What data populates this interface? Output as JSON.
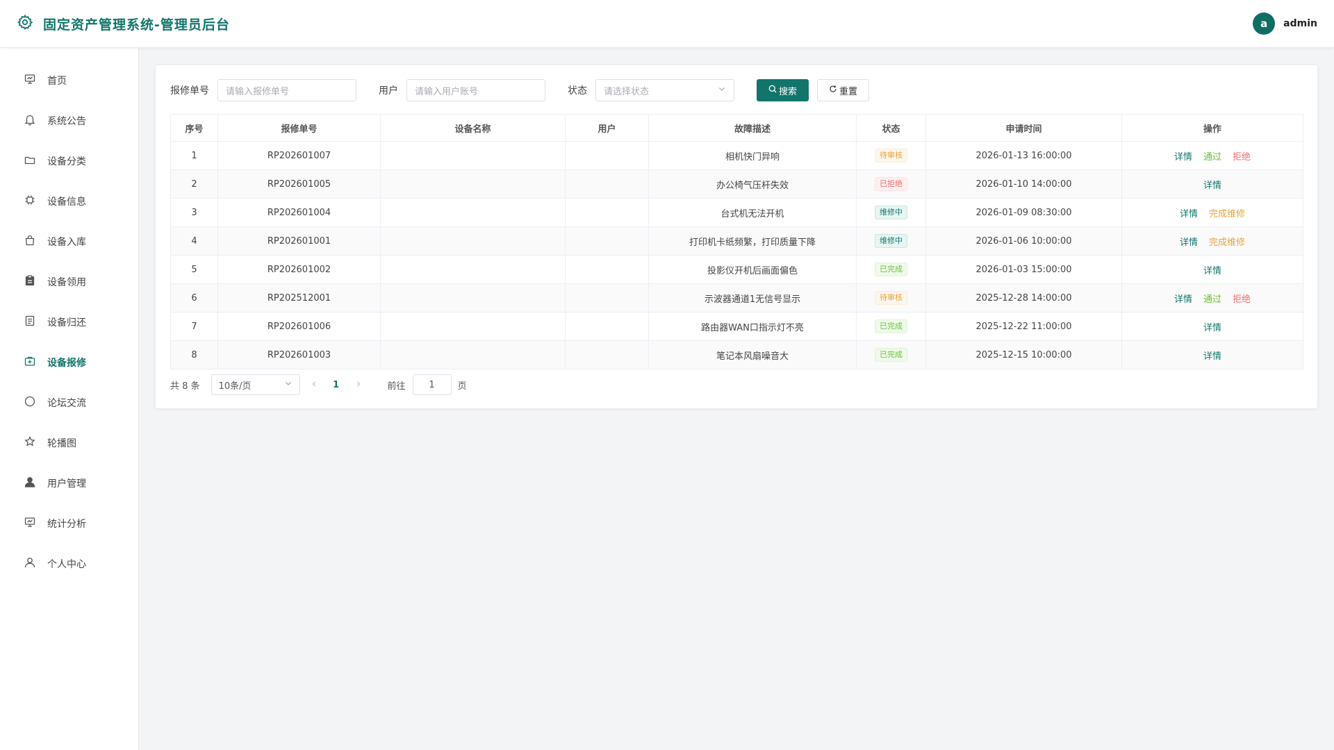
{
  "app": {
    "title": "固定资产管理系统-管理员后台",
    "user": {
      "avatar_letter": "a",
      "name": "admin"
    }
  },
  "colors": {
    "brand": "#11756b",
    "pending": "#e6a23c",
    "rejected": "#f56c6c",
    "done": "#67c23a"
  },
  "sidebar": {
    "items": [
      {
        "label": "首页",
        "icon": "dashboard-icon"
      },
      {
        "label": "系统公告",
        "icon": "bell-icon"
      },
      {
        "label": "设备分类",
        "icon": "folder-icon"
      },
      {
        "label": "设备信息",
        "icon": "chip-icon"
      },
      {
        "label": "设备入库",
        "icon": "bag-icon"
      },
      {
        "label": "设备领用",
        "icon": "clipboard-icon"
      },
      {
        "label": "设备归还",
        "icon": "document-icon"
      },
      {
        "label": "设备报修",
        "icon": "repair-box-icon",
        "active": true
      },
      {
        "label": "论坛交流",
        "icon": "chat-icon"
      },
      {
        "label": "轮播图",
        "icon": "star-icon"
      },
      {
        "label": "用户管理",
        "icon": "user-filled-icon"
      },
      {
        "label": "统计分析",
        "icon": "chart-board-icon"
      },
      {
        "label": "个人中心",
        "icon": "user-outline-icon"
      }
    ]
  },
  "filters": {
    "repair_no_label": "报修单号",
    "repair_no_placeholder": "请输入报修单号",
    "user_label": "用户",
    "user_placeholder": "请输入用户账号",
    "status_label": "状态",
    "status_placeholder": "请选择状态",
    "search_label": "搜索",
    "reset_label": "重置"
  },
  "table": {
    "headers": [
      "序号",
      "报修单号",
      "设备名称",
      "用户",
      "故障描述",
      "状态",
      "申请时间",
      "操作"
    ],
    "rows": [
      {
        "idx": "1",
        "no": "RP202601007",
        "device": "",
        "user": "",
        "desc": "相机快门异响",
        "status": "待审核",
        "status_type": "pending",
        "time": "2026-01-13 16:00:00",
        "actions": [
          {
            "label": "详情",
            "type": "detail"
          },
          {
            "label": "通过",
            "type": "pass"
          },
          {
            "label": "拒绝",
            "type": "reject"
          }
        ]
      },
      {
        "idx": "2",
        "no": "RP202601005",
        "device": "",
        "user": "",
        "desc": "办公椅气压杆失效",
        "status": "已拒绝",
        "status_type": "rejected",
        "time": "2026-01-10 14:00:00",
        "actions": [
          {
            "label": "详情",
            "type": "detail"
          }
        ]
      },
      {
        "idx": "3",
        "no": "RP202601004",
        "device": "",
        "user": "",
        "desc": "台式机无法开机",
        "status": "维修中",
        "status_type": "repair",
        "time": "2026-01-09 08:30:00",
        "actions": [
          {
            "label": "详情",
            "type": "detail"
          },
          {
            "label": "完成维修",
            "type": "finish"
          }
        ]
      },
      {
        "idx": "4",
        "no": "RP202601001",
        "device": "",
        "user": "",
        "desc": "打印机卡纸频繁，打印质量下降",
        "status": "维修中",
        "status_type": "repair",
        "time": "2026-01-06 10:00:00",
        "actions": [
          {
            "label": "详情",
            "type": "detail"
          },
          {
            "label": "完成维修",
            "type": "finish"
          }
        ]
      },
      {
        "idx": "5",
        "no": "RP202601002",
        "device": "",
        "user": "",
        "desc": "投影仪开机后画面偏色",
        "status": "已完成",
        "status_type": "done",
        "time": "2026-01-03 15:00:00",
        "actions": [
          {
            "label": "详情",
            "type": "detail"
          }
        ]
      },
      {
        "idx": "6",
        "no": "RP202512001",
        "device": "",
        "user": "",
        "desc": "示波器通道1无信号显示",
        "status": "待审核",
        "status_type": "pending",
        "time": "2025-12-28 14:00:00",
        "actions": [
          {
            "label": "详情",
            "type": "detail"
          },
          {
            "label": "通过",
            "type": "pass"
          },
          {
            "label": "拒绝",
            "type": "reject"
          }
        ]
      },
      {
        "idx": "7",
        "no": "RP202601006",
        "device": "",
        "user": "",
        "desc": "路由器WAN口指示灯不亮",
        "status": "已完成",
        "status_type": "done",
        "time": "2025-12-22 11:00:00",
        "actions": [
          {
            "label": "详情",
            "type": "detail"
          }
        ]
      },
      {
        "idx": "8",
        "no": "RP202601003",
        "device": "",
        "user": "",
        "desc": "笔记本风扇噪音大",
        "status": "已完成",
        "status_type": "done",
        "time": "2025-12-15 10:00:00",
        "actions": [
          {
            "label": "详情",
            "type": "detail"
          }
        ]
      }
    ]
  },
  "pagination": {
    "total_text": "共 8 条",
    "page_size": "10条/页",
    "current_page": "1",
    "jump_prefix": "前往",
    "jump_value": "1",
    "jump_suffix": "页"
  }
}
